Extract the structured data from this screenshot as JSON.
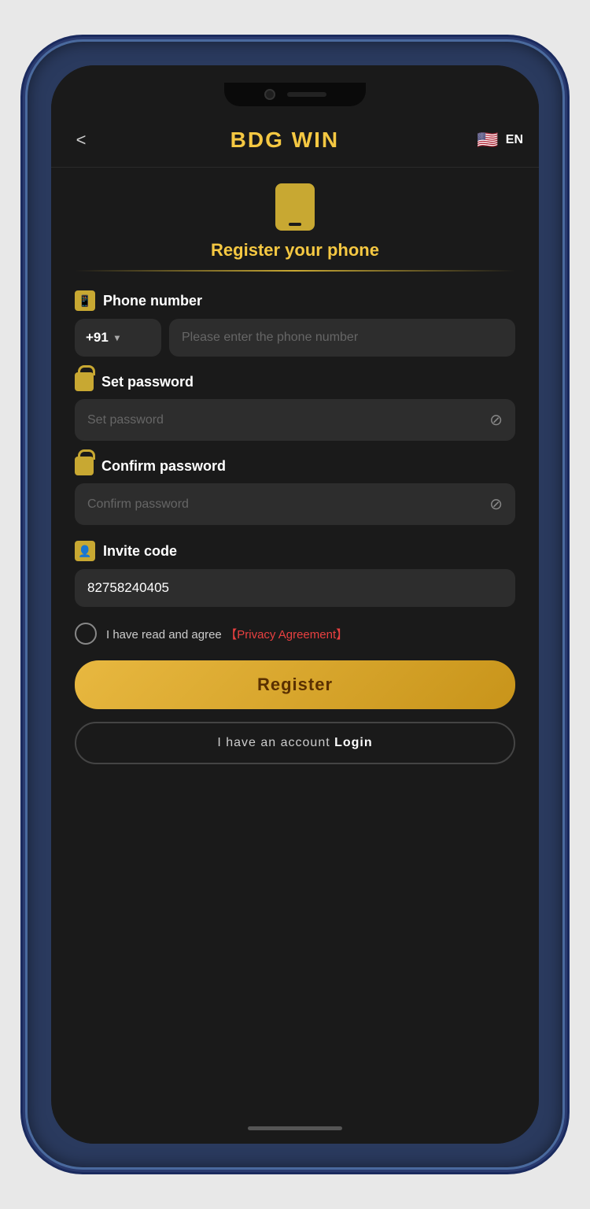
{
  "app": {
    "title": "BDG WIN",
    "back_label": "<",
    "language": "EN"
  },
  "page": {
    "icon_label": "phone-register-icon",
    "title": "Register your phone"
  },
  "form": {
    "phone_section": {
      "label": "Phone number",
      "country_code": "+91",
      "phone_placeholder": "Please enter the phone number"
    },
    "password_section": {
      "label": "Set password",
      "placeholder": "Set password"
    },
    "confirm_password_section": {
      "label": "Confirm password",
      "placeholder": "Confirm password"
    },
    "invite_section": {
      "label": "Invite code",
      "value": "82758240405"
    },
    "agreement": {
      "text": "I have read and agree",
      "link_text": "【Privacy Agreement】"
    },
    "register_btn": "Register",
    "login_btn_text": "I have an account",
    "login_btn_bold": "Login"
  }
}
